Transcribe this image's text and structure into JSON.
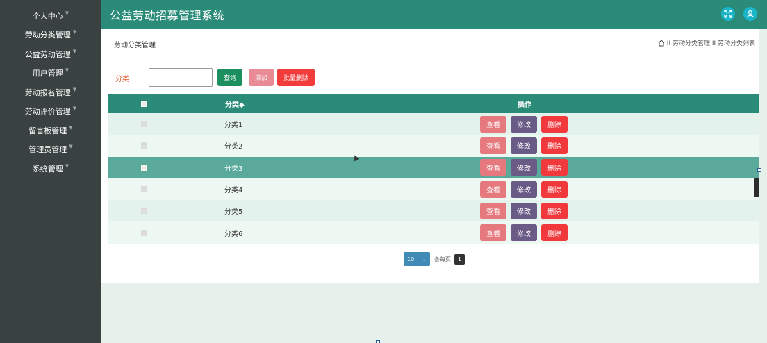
{
  "app": {
    "title": "公益劳动招募管理系统"
  },
  "sidebar": {
    "items": [
      {
        "label": "个人中心"
      },
      {
        "label": "劳动分类管理"
      },
      {
        "label": "公益劳动管理"
      },
      {
        "label": "用户管理"
      },
      {
        "label": "劳动报名管理"
      },
      {
        "label": "劳动评价管理"
      },
      {
        "label": "留言板管理"
      },
      {
        "label": "管理员管理"
      },
      {
        "label": "系统管理"
      }
    ]
  },
  "page": {
    "title": "劳动分类管理",
    "breadcrumb": "II 劳动分类管理 II 劳动分类列表"
  },
  "search": {
    "label": "分类",
    "value": "",
    "query_label": "查询",
    "add_label": "添加",
    "batch_delete_label": "批量删除"
  },
  "table": {
    "headers": {
      "category": "分类◆",
      "operation": "操作"
    },
    "rows": [
      {
        "category": "分类1"
      },
      {
        "category": "分类2"
      },
      {
        "category": "分类3"
      },
      {
        "category": "分类4"
      },
      {
        "category": "分类5"
      },
      {
        "category": "分类6"
      }
    ],
    "actions": {
      "view": "查看",
      "edit": "修改",
      "delete": "删除"
    }
  },
  "pagination": {
    "page_size": "10",
    "per_page_label": "条每页",
    "current_page": "1"
  },
  "colors": {
    "header": "#2a8c78",
    "sidebar": "#3a4241",
    "highlight_row": "#5aa99a",
    "view_btn": "#e6797e",
    "edit_btn": "#6a5a86",
    "delete_btn": "#f1383c"
  }
}
